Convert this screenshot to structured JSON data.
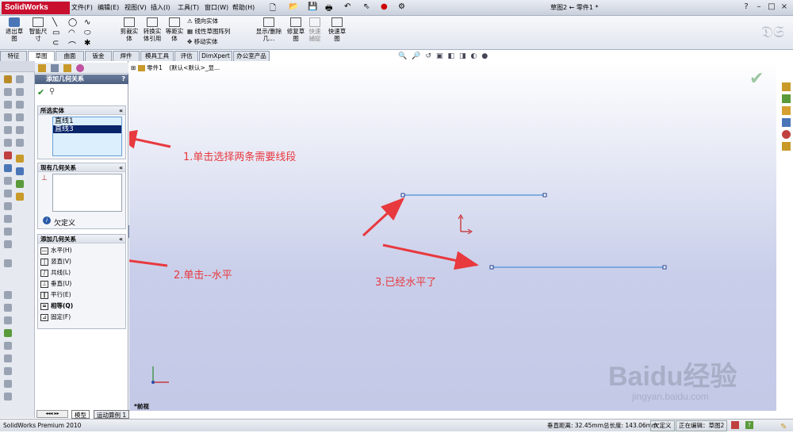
{
  "app": {
    "name": "SolidWorks",
    "doc_title": "草图2 ← 零件1 *"
  },
  "menu": [
    "文件(F)",
    "编辑(E)",
    "视图(V)",
    "插入(I)",
    "工具(T)",
    "窗口(W)",
    "帮助(H)"
  ],
  "window_controls": [
    "?",
    "–",
    "□",
    "×"
  ],
  "commands": {
    "exit_sketch": "退出草图",
    "smart_dim": "智能尺寸",
    "trim": "剪裁实体",
    "convert": "转换实体引用",
    "offset": "等距实体",
    "mirror": "镜向实体",
    "linear_pattern": "线性草图阵列",
    "move": "移动实体",
    "show_hide": "显示/删除几...",
    "repair": "修复草图",
    "quick_snaps": "快速捕捉",
    "rapid_sketch": "快速草图"
  },
  "tabs": [
    "特征",
    "草图",
    "曲面",
    "钣金",
    "焊件",
    "模具工具",
    "评估",
    "DimXpert",
    "办公室产品"
  ],
  "feature_tree": {
    "part": "零件1",
    "config": "(默认<默认>_显..."
  },
  "property_manager": {
    "title": "添加几何关系",
    "help": "?",
    "selected_entities": {
      "title": "所选实体",
      "items": [
        "直线1",
        "直线3"
      ]
    },
    "existing_relations": {
      "title": "现有几何关系",
      "status": "欠定义"
    },
    "add_relations": {
      "title": "添加几何关系",
      "items": [
        {
          "label": "水平(H)",
          "icon": "—"
        },
        {
          "label": "竖直(V)",
          "icon": "|"
        },
        {
          "label": "共线(L)",
          "icon": "/"
        },
        {
          "label": "垂直(U)",
          "icon": "⊥"
        },
        {
          "label": "平行(E)",
          "icon": "∥"
        },
        {
          "label": "相等(Q)",
          "icon": "="
        },
        {
          "label": "固定(F)",
          "icon": "⊿"
        }
      ]
    }
  },
  "annotations": {
    "step1": "1.单击选择两条需要线段",
    "step2": "2.单击--水平",
    "step3": "3.已经水平了"
  },
  "view_label": "*前视",
  "bottom_tabs": [
    "模型",
    "运动算例 1"
  ],
  "status": {
    "product": "SolidWorks Premium 2010",
    "measure": "垂直距离: 32.45mm总长度: 143.06mm",
    "state": "欠定义",
    "editing": "正在编辑：草图2"
  },
  "watermark": {
    "brand": "Baidu经验",
    "url": "jingyan.baidu.com"
  },
  "colors": {
    "accent": "#e8393f",
    "line": "#4a8fd8",
    "selected": "#0a246a"
  }
}
